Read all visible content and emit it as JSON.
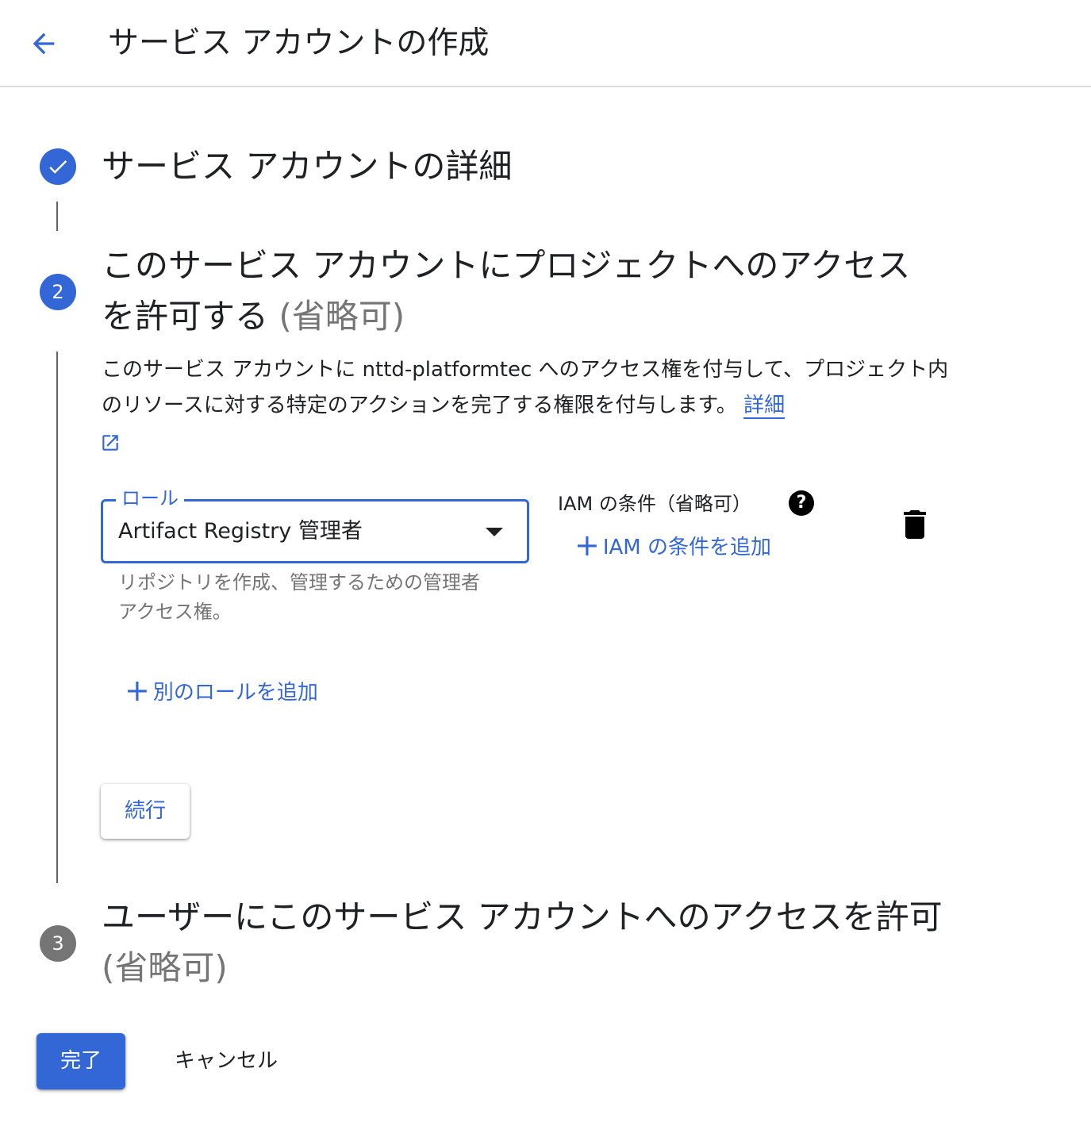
{
  "header": {
    "title": "サービス アカウントの作成"
  },
  "steps": {
    "step1": {
      "title": "サービス アカウントの詳細"
    },
    "step2": {
      "number": "2",
      "title": "このサービス アカウントにプロジェクトへのアクセスを許可する",
      "optional": "(省略可)",
      "description": "このサービス アカウントに nttd-platformtec へのアクセス権を付与して、プロジェクト内のリソースに対する特定のアクションを完了する権限を付与します。",
      "details_link": "詳細",
      "role_field": {
        "label": "ロール",
        "value": "Artifact Registry 管理者",
        "hint": "リポジトリを作成、管理するための管理者アクセス権。"
      },
      "iam_condition": {
        "title": "IAM の条件（省略可）",
        "help_glyph": "?",
        "add_label": "IAM の条件を追加"
      },
      "add_role_label": "別のロールを追加",
      "continue_label": "続行"
    },
    "step3": {
      "number": "3",
      "title": "ユーザーにこのサービス アカウントへのアクセスを許可",
      "optional": "(省略可)"
    }
  },
  "footer": {
    "done_label": "完了",
    "cancel_label": "キャンセル"
  },
  "icons": {
    "back": "arrow-back-icon",
    "step_done": "check-icon",
    "external_link": "open-in-new-icon",
    "dropdown": "arrow-drop-down-icon",
    "help": "help-icon",
    "add": "plus-icon",
    "delete": "trash-icon"
  },
  "colors": {
    "primary": "#3367d6",
    "text": "#202124",
    "secondary_text": "#757575",
    "inactive_step": "#757575",
    "divider": "#dadce0"
  }
}
